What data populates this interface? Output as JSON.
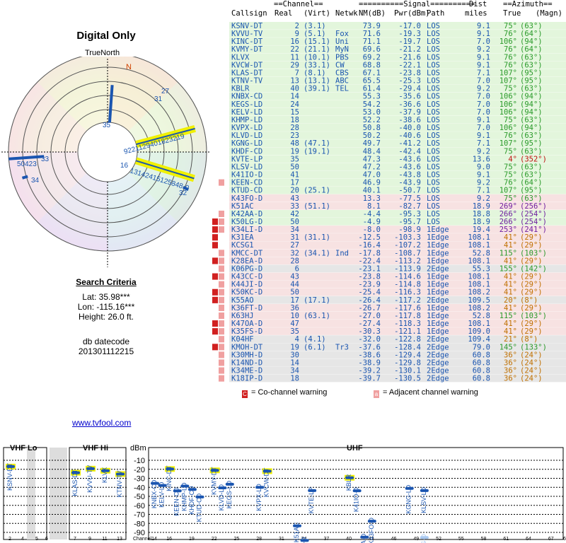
{
  "panel": {
    "title": "Digital Only",
    "true_north": "TrueNorth",
    "north": "N"
  },
  "criteria": {
    "heading": "Search Criteria",
    "lat": "Lat: 35.98***",
    "lon": "Lon: -115.16***",
    "height": "Height: 26.0 ft.",
    "datecode_label": "db datecode",
    "datecode": "201301112215"
  },
  "legend": {
    "co_channel": "= Co-channel warning",
    "adjacent": "= Adjacent channel warning",
    "co_letter": "C",
    "adj_letter": "a"
  },
  "link": "www.tvfool.com",
  "colors": {
    "los": "#e3f6dc",
    "oneedge": "#f7e2e2",
    "twoedge": "#e6e6e6",
    "co_warn": "#d12020",
    "adj_warn": "#f0a0a0",
    "marker": "#1a55b0",
    "highlight": "#f0f000"
  },
  "table": {
    "hdr1": [
      "==Channel==",
      "==========Signal==========",
      "Dist",
      "==Azimuth=="
    ],
    "cols": [
      "Callsign",
      "Real",
      "(Virt)",
      "Netwk",
      "NM(dB)",
      "Pwr(dBm)",
      "Path",
      "miles",
      "True",
      "(Magn)"
    ],
    "rows": [
      {
        "call": "KSNV-DT",
        "real": "2",
        "virt": "(3.1)",
        "net": "",
        "nm": "73.9",
        "pwr": "-17.0",
        "path": "LOS",
        "dist": "9.1",
        "true": "75°",
        "magn": "(63°)",
        "warn": ""
      },
      {
        "call": "KVVU-TV",
        "real": "9",
        "virt": "(5.1)",
        "net": "Fox",
        "nm": "71.6",
        "pwr": "-19.3",
        "path": "LOS",
        "dist": "9.1",
        "true": "76°",
        "magn": "(64°)",
        "warn": ""
      },
      {
        "call": "KINC-DT",
        "real": "16",
        "virt": "(15.1)",
        "net": "Uni",
        "nm": "71.1",
        "pwr": "-19.7",
        "path": "LOS",
        "dist": "7.0",
        "true": "106°",
        "magn": "(94°)",
        "warn": ""
      },
      {
        "call": "KVMY-DT",
        "real": "22",
        "virt": "(21.1)",
        "net": "MyN",
        "nm": "69.6",
        "pwr": "-21.2",
        "path": "LOS",
        "dist": "9.2",
        "true": "76°",
        "magn": "(64°)",
        "warn": ""
      },
      {
        "call": "KLVX",
        "real": "11",
        "virt": "(10.1)",
        "net": "PBS",
        "nm": "69.2",
        "pwr": "-21.6",
        "path": "LOS",
        "dist": "9.1",
        "true": "76°",
        "magn": "(63°)",
        "warn": ""
      },
      {
        "call": "KVCW-DT",
        "real": "29",
        "virt": "(33.1)",
        "net": "CW",
        "nm": "68.8",
        "pwr": "-22.1",
        "path": "LOS",
        "dist": "9.1",
        "true": "76°",
        "magn": "(63°)",
        "warn": ""
      },
      {
        "call": "KLAS-DT",
        "real": "7",
        "virt": "(8.1)",
        "net": "CBS",
        "nm": "67.1",
        "pwr": "-23.8",
        "path": "LOS",
        "dist": "7.1",
        "true": "107°",
        "magn": "(95°)",
        "warn": ""
      },
      {
        "call": "KTNV-TV",
        "real": "13",
        "virt": "(13.1)",
        "net": "ABC",
        "nm": "65.5",
        "pwr": "-25.3",
        "path": "LOS",
        "dist": "7.0",
        "true": "107°",
        "magn": "(95°)",
        "warn": ""
      },
      {
        "call": "KBLR",
        "real": "40",
        "virt": "(39.1)",
        "net": "TEL",
        "nm": "61.4",
        "pwr": "-29.4",
        "path": "LOS",
        "dist": "9.2",
        "true": "75°",
        "magn": "(63°)",
        "warn": ""
      },
      {
        "call": "KNBX-CD",
        "real": "14",
        "virt": "",
        "net": "",
        "nm": "55.3",
        "pwr": "-35.6",
        "path": "LOS",
        "dist": "7.0",
        "true": "106°",
        "magn": "(94°)",
        "warn": ""
      },
      {
        "call": "KEGS-LD",
        "real": "24",
        "virt": "",
        "net": "",
        "nm": "54.2",
        "pwr": "-36.6",
        "path": "LOS",
        "dist": "7.0",
        "true": "106°",
        "magn": "(94°)",
        "warn": ""
      },
      {
        "call": "KELV-LD",
        "real": "15",
        "virt": "",
        "net": "",
        "nm": "53.0",
        "pwr": "-37.9",
        "path": "LOS",
        "dist": "7.0",
        "true": "106°",
        "magn": "(94°)",
        "warn": ""
      },
      {
        "call": "KHMP-LD",
        "real": "18",
        "virt": "",
        "net": "",
        "nm": "52.2",
        "pwr": "-38.6",
        "path": "LOS",
        "dist": "9.1",
        "true": "75°",
        "magn": "(63°)",
        "warn": ""
      },
      {
        "call": "KVPX-LD",
        "real": "28",
        "virt": "",
        "net": "",
        "nm": "50.8",
        "pwr": "-40.0",
        "path": "LOS",
        "dist": "7.0",
        "true": "106°",
        "magn": "(94°)",
        "warn": ""
      },
      {
        "call": "KLVD-LD",
        "real": "23",
        "virt": "",
        "net": "",
        "nm": "50.2",
        "pwr": "-40.6",
        "path": "LOS",
        "dist": "9.1",
        "true": "76°",
        "magn": "(63°)",
        "warn": ""
      },
      {
        "call": "KGNG-LD",
        "real": "48",
        "virt": "(47.1)",
        "net": "",
        "nm": "49.7",
        "pwr": "-41.2",
        "path": "LOS",
        "dist": "7.1",
        "true": "107°",
        "magn": "(95°)",
        "warn": ""
      },
      {
        "call": "KHDF-CD",
        "real": "19",
        "virt": "(19.1)",
        "net": "",
        "nm": "48.4",
        "pwr": "-42.4",
        "path": "LOS",
        "dist": "9.2",
        "true": "75°",
        "magn": "(63°)",
        "warn": ""
      },
      {
        "call": "KVTE-LP",
        "real": "35",
        "virt": "",
        "net": "",
        "nm": "47.3",
        "pwr": "-43.6",
        "path": "LOS",
        "dist": "13.6",
        "true": "4°",
        "magn": "(352°)",
        "warn": ""
      },
      {
        "call": "KLSV-LD",
        "real": "50",
        "virt": "",
        "net": "",
        "nm": "47.2",
        "pwr": "-43.6",
        "path": "LOS",
        "dist": "9.0",
        "true": "75°",
        "magn": "(63°)",
        "warn": ""
      },
      {
        "call": "K41IO-D",
        "real": "41",
        "virt": "",
        "net": "",
        "nm": "47.0",
        "pwr": "-43.8",
        "path": "LOS",
        "dist": "9.1",
        "true": "75°",
        "magn": "(63°)",
        "warn": ""
      },
      {
        "call": "KEEN-CD",
        "real": "17",
        "virt": "",
        "net": "",
        "nm": "46.9",
        "pwr": "-43.9",
        "path": "LOS",
        "dist": "9.2",
        "true": "76°",
        "magn": "(64°)",
        "warn": "a"
      },
      {
        "call": "KTUD-CD",
        "real": "20",
        "virt": "(25.1)",
        "net": "",
        "nm": "40.1",
        "pwr": "-50.7",
        "path": "LOS",
        "dist": "7.1",
        "true": "107°",
        "magn": "(95°)",
        "warn": ""
      },
      {
        "call": "K43FO-D",
        "real": "43",
        "virt": "",
        "net": "",
        "nm": "13.3",
        "pwr": "-77.5",
        "path": "LOS",
        "dist": "9.2",
        "true": "75°",
        "magn": "(63°)",
        "warn": ""
      },
      {
        "call": "K51AC",
        "real": "33",
        "virt": "(51.1)",
        "net": "",
        "nm": "8.1",
        "pwr": "-82.7",
        "path": "LOS",
        "dist": "18.9",
        "true": "269°",
        "magn": "(256°)",
        "warn": ""
      },
      {
        "call": "K42AA-D",
        "real": "42",
        "virt": "",
        "net": "",
        "nm": "-4.4",
        "pwr": "-95.3",
        "path": "LOS",
        "dist": "18.8",
        "true": "266°",
        "magn": "(254°)",
        "warn": "a"
      },
      {
        "call": "K50LG-D",
        "real": "50",
        "virt": "",
        "net": "",
        "nm": "-4.9",
        "pwr": "-95.7",
        "path": "LOS",
        "dist": "18.9",
        "true": "266°",
        "magn": "(254°)",
        "warn": "Ca"
      },
      {
        "call": "K34LI-D",
        "real": "34",
        "virt": "",
        "net": "",
        "nm": "-8.0",
        "pwr": "-98.9",
        "path": "1Edge",
        "dist": "19.4",
        "true": "253°",
        "magn": "(241°)",
        "warn": "Ca"
      },
      {
        "call": "K31EA",
        "real": "31",
        "virt": "(31.1)",
        "net": "",
        "nm": "-12.5",
        "pwr": "-103.3",
        "path": "1Edge",
        "dist": "108.1",
        "true": "41°",
        "magn": "(29°)",
        "warn": "C"
      },
      {
        "call": "KCSG1",
        "real": "27",
        "virt": "",
        "net": "",
        "nm": "-16.4",
        "pwr": "-107.2",
        "path": "1Edge",
        "dist": "108.1",
        "true": "41°",
        "magn": "(29°)",
        "warn": "C"
      },
      {
        "call": "KMCC-DT",
        "real": "32",
        "virt": "(34.1)",
        "net": "Ind",
        "nm": "-17.8",
        "pwr": "-108.7",
        "path": "1Edge",
        "dist": "52.8",
        "true": "115°",
        "magn": "(103°)",
        "warn": "a"
      },
      {
        "call": "K28EA-D",
        "real": "28",
        "virt": "",
        "net": "",
        "nm": "-22.4",
        "pwr": "-113.2",
        "path": "1Edge",
        "dist": "108.1",
        "true": "41°",
        "magn": "(29°)",
        "warn": "Ca"
      },
      {
        "call": "K06PG-D",
        "real": "6",
        "virt": "",
        "net": "",
        "nm": "-23.1",
        "pwr": "-113.9",
        "path": "2Edge",
        "dist": "55.3",
        "true": "155°",
        "magn": "(142°)",
        "warn": "a"
      },
      {
        "call": "K43CC-D",
        "real": "43",
        "virt": "",
        "net": "",
        "nm": "-23.8",
        "pwr": "-114.6",
        "path": "1Edge",
        "dist": "108.1",
        "true": "41°",
        "magn": "(29°)",
        "warn": "Ca"
      },
      {
        "call": "K44JI-D",
        "real": "44",
        "virt": "",
        "net": "",
        "nm": "-23.9",
        "pwr": "-114.8",
        "path": "1Edge",
        "dist": "108.1",
        "true": "41°",
        "magn": "(29°)",
        "warn": "a"
      },
      {
        "call": "K50KC-D",
        "real": "50",
        "virt": "",
        "net": "",
        "nm": "-25.4",
        "pwr": "-116.3",
        "path": "1Edge",
        "dist": "108.2",
        "true": "41°",
        "magn": "(29°)",
        "warn": "Ca"
      },
      {
        "call": "K55AO",
        "real": "17",
        "virt": "(17.1)",
        "net": "",
        "nm": "-26.4",
        "pwr": "-117.2",
        "path": "2Edge",
        "dist": "109.5",
        "true": "20°",
        "magn": "(8°)",
        "warn": "Ca"
      },
      {
        "call": "K36FT-D",
        "real": "36",
        "virt": "",
        "net": "",
        "nm": "-26.7",
        "pwr": "-117.6",
        "path": "1Edge",
        "dist": "108.2",
        "true": "41°",
        "magn": "(29°)",
        "warn": "a"
      },
      {
        "call": "K63HJ",
        "real": "10",
        "virt": "(63.1)",
        "net": "",
        "nm": "-27.0",
        "pwr": "-117.8",
        "path": "1Edge",
        "dist": "52.8",
        "true": "115°",
        "magn": "(103°)",
        "warn": "a"
      },
      {
        "call": "K47OA-D",
        "real": "47",
        "virt": "",
        "net": "",
        "nm": "-27.4",
        "pwr": "-118.3",
        "path": "1Edge",
        "dist": "108.1",
        "true": "41°",
        "magn": "(29°)",
        "warn": "Ca"
      },
      {
        "call": "K35FS-D",
        "real": "35",
        "virt": "",
        "net": "",
        "nm": "-30.3",
        "pwr": "-121.1",
        "path": "1Edge",
        "dist": "109.0",
        "true": "41°",
        "magn": "(29°)",
        "warn": "Ca"
      },
      {
        "call": "K04HF",
        "real": "4",
        "virt": "(4.1)",
        "net": "",
        "nm": "-32.0",
        "pwr": "-122.8",
        "path": "2Edge",
        "dist": "109.4",
        "true": "21°",
        "magn": "(8°)",
        "warn": "a"
      },
      {
        "call": "KMOH-DT",
        "real": "19",
        "virt": "(6.1)",
        "net": "Tr3",
        "nm": "-37.6",
        "pwr": "-128.4",
        "path": "2Edge",
        "dist": "79.0",
        "true": "145°",
        "magn": "(133°)",
        "warn": "Ca"
      },
      {
        "call": "K30MH-D",
        "real": "30",
        "virt": "",
        "net": "",
        "nm": "-38.6",
        "pwr": "-129.4",
        "path": "2Edge",
        "dist": "60.8",
        "true": "36°",
        "magn": "(24°)",
        "warn": "a"
      },
      {
        "call": "K14ND-D",
        "real": "14",
        "virt": "",
        "net": "",
        "nm": "-38.9",
        "pwr": "-129.8",
        "path": "2Edge",
        "dist": "60.8",
        "true": "36°",
        "magn": "(24°)",
        "warn": "a"
      },
      {
        "call": "K34ME-D",
        "real": "34",
        "virt": "",
        "net": "",
        "nm": "-39.2",
        "pwr": "-130.1",
        "path": "2Edge",
        "dist": "60.8",
        "true": "36°",
        "magn": "(24°)",
        "warn": "a"
      },
      {
        "call": "K18IP-D",
        "real": "18",
        "virt": "",
        "net": "",
        "nm": "-39.7",
        "pwr": "-130.5",
        "path": "2Edge",
        "dist": "60.8",
        "true": "36°",
        "magn": "(24°)",
        "warn": "a"
      }
    ]
  },
  "polar_labels": [
    {
      "text": "35",
      "az": 4
    },
    {
      "text": "27",
      "az": 41
    },
    {
      "text": "31",
      "az": 36
    },
    {
      "text": "9221129401823219",
      "az": 75
    },
    {
      "text": "16",
      "az": 106
    },
    {
      "text": "13142415125848-0",
      "az": 107
    },
    {
      "text": "32",
      "az": 115
    },
    {
      "text": "50423",
      "az": 266
    },
    {
      "text": "34",
      "az": 253
    },
    {
      "text": "33",
      "az": 269
    }
  ],
  "chart_data": {
    "type": "bar",
    "title": "",
    "ylabel": "dBm",
    "xlabel": "Channel",
    "ylim": [
      -90,
      -10
    ],
    "yticks": [
      -10,
      -20,
      -30,
      -40,
      -50,
      -60,
      -70,
      -80,
      -90
    ],
    "bands": [
      "VHF Lo",
      "VHF Hi",
      "UHF"
    ],
    "x_tick_labels": [
      "2",
      "4",
      "5",
      "6",
      "7",
      "9",
      "11",
      "13",
      "14",
      "16",
      "19",
      "22",
      "25",
      "28",
      "31",
      "34",
      "37",
      "40",
      "43",
      "46",
      "49",
      "52",
      "55",
      "58",
      "61",
      "64",
      "67",
      "69"
    ],
    "stations": [
      {
        "call": "KSNV-DT",
        "ch": 2,
        "dbm": -17.0
      },
      {
        "call": "KLAS-DT",
        "ch": 7,
        "dbm": -23.8
      },
      {
        "call": "KVVU-TV",
        "ch": 9,
        "dbm": -19.3
      },
      {
        "call": "KLVX",
        "ch": 11,
        "dbm": -21.6
      },
      {
        "call": "KTNV-TV",
        "ch": 13,
        "dbm": -25.3
      },
      {
        "call": "KNBX-CD",
        "ch": 14,
        "dbm": -35.6
      },
      {
        "call": "KELV-LD",
        "ch": 15,
        "dbm": -37.9
      },
      {
        "call": "KINC-DT",
        "ch": 16,
        "dbm": -19.7
      },
      {
        "call": "KEEN-CD",
        "ch": 17,
        "dbm": -43.9
      },
      {
        "call": "KHMP-LD",
        "ch": 18,
        "dbm": -38.6
      },
      {
        "call": "KHDF-CD",
        "ch": 19,
        "dbm": -42.4
      },
      {
        "call": "KTUD-CD",
        "ch": 20,
        "dbm": -50.7
      },
      {
        "call": "KVMY-DT",
        "ch": 22,
        "dbm": -21.2
      },
      {
        "call": "KLVD-LD",
        "ch": 23,
        "dbm": -40.6
      },
      {
        "call": "KEGS-LD",
        "ch": 24,
        "dbm": -36.6
      },
      {
        "call": "KVPX-LD",
        "ch": 28,
        "dbm": -40.0
      },
      {
        "call": "KVCW-DT",
        "ch": 29,
        "dbm": -22.1
      },
      {
        "call": "K51AC",
        "ch": 33,
        "dbm": -82.7
      },
      {
        "call": "K34LI-D",
        "ch": 34,
        "dbm": -98.9
      },
      {
        "call": "KVTE-LP",
        "ch": 35,
        "dbm": -43.6
      },
      {
        "call": "KBLR",
        "ch": 40,
        "dbm": -29.4
      },
      {
        "call": "K41IO-D",
        "ch": 41,
        "dbm": -43.8
      },
      {
        "call": "K42AA-D",
        "ch": 42,
        "dbm": -95.3
      },
      {
        "call": "K43FO-D",
        "ch": 43,
        "dbm": -77.5
      },
      {
        "call": "KGNG-LD",
        "ch": 48,
        "dbm": -41.2
      },
      {
        "call": "KLSV-LD",
        "ch": 50,
        "dbm": -43.6
      },
      {
        "call": "K50LG-D",
        "ch": 50,
        "dbm": -95.7
      }
    ]
  }
}
